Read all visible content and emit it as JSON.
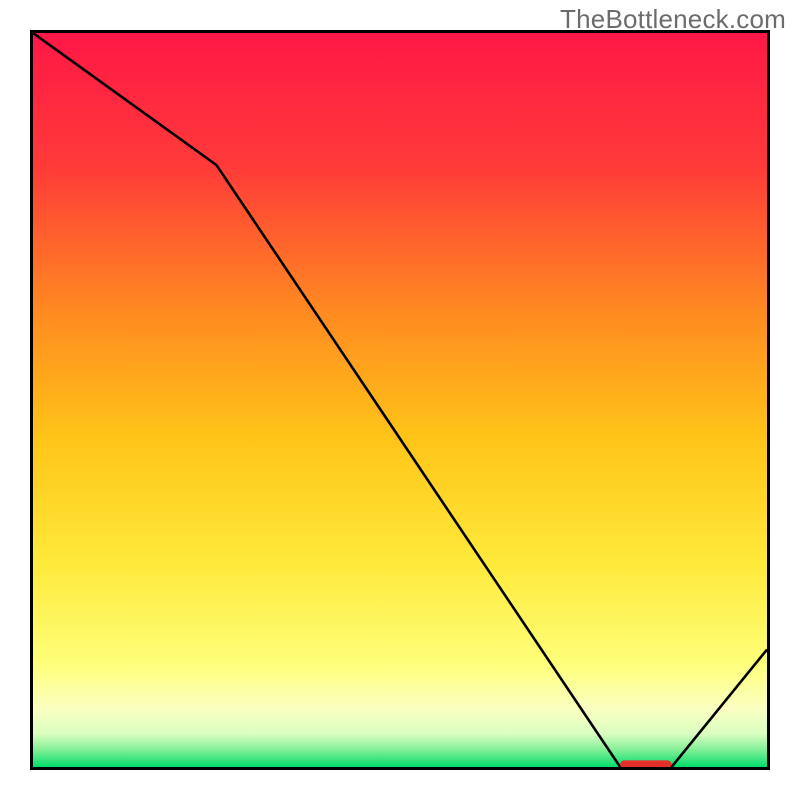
{
  "watermark": "TheBottleneck.com",
  "chart_data": {
    "type": "line",
    "title": "",
    "xlabel": "",
    "ylabel": "",
    "xlim": [
      0,
      100
    ],
    "ylim": [
      0,
      100
    ],
    "x": [
      0,
      25,
      80,
      87,
      100
    ],
    "values": [
      100,
      82,
      0,
      0,
      16
    ],
    "marker_segment": {
      "x0": 80,
      "x1": 87,
      "y": 0
    },
    "background_gradient": {
      "stops": [
        {
          "offset": 0.0,
          "color": "#ff1846"
        },
        {
          "offset": 0.18,
          "color": "#ff3a39"
        },
        {
          "offset": 0.38,
          "color": "#ff8a21"
        },
        {
          "offset": 0.55,
          "color": "#ffc418"
        },
        {
          "offset": 0.72,
          "color": "#ffe93a"
        },
        {
          "offset": 0.86,
          "color": "#feff7a"
        },
        {
          "offset": 0.92,
          "color": "#fbffc0"
        },
        {
          "offset": 0.955,
          "color": "#d9ffc0"
        },
        {
          "offset": 0.975,
          "color": "#8af09a"
        },
        {
          "offset": 1.0,
          "color": "#02de6a"
        }
      ]
    },
    "line_color": "#000000",
    "marker_color": "#e32e2c"
  }
}
